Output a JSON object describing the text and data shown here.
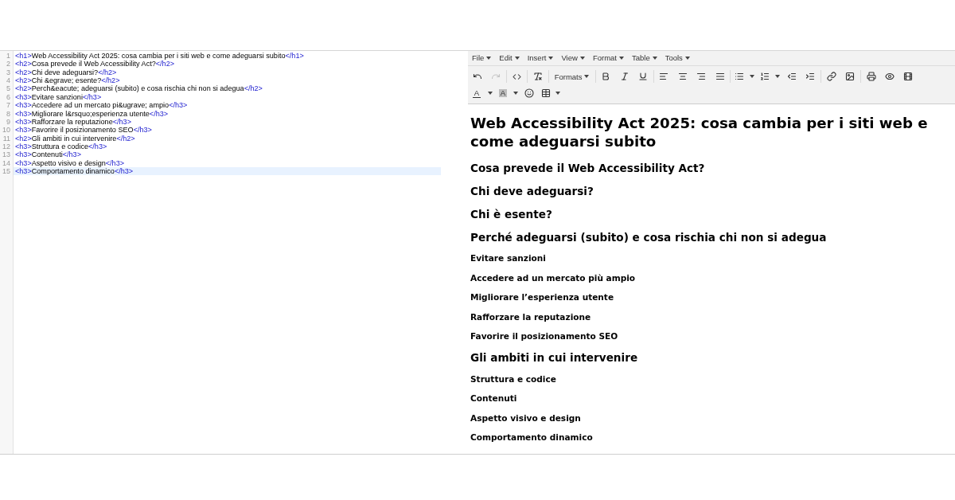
{
  "code_editor": {
    "lines": [
      {
        "number": "1",
        "active": false,
        "tokens": [
          {
            "kind": "tag",
            "text": "<h1>"
          },
          {
            "kind": "text",
            "text": "Web Accessibility Act 2025: cosa cambia per i siti web e come adeguarsi subito"
          },
          {
            "kind": "tag",
            "text": "</h1>"
          }
        ]
      },
      {
        "number": "2",
        "active": false,
        "tokens": [
          {
            "kind": "tag",
            "text": "<h2>"
          },
          {
            "kind": "text",
            "text": "Cosa prevede il Web Accessibility Act?"
          },
          {
            "kind": "tag",
            "text": "</h2>"
          }
        ]
      },
      {
        "number": "3",
        "active": false,
        "tokens": [
          {
            "kind": "tag",
            "text": "<h2>"
          },
          {
            "kind": "text",
            "text": "Chi deve adeguarsi?"
          },
          {
            "kind": "tag",
            "text": "</h2>"
          }
        ]
      },
      {
        "number": "4",
        "active": false,
        "tokens": [
          {
            "kind": "tag",
            "text": "<h2>"
          },
          {
            "kind": "text",
            "text": "Chi &egrave; esente?"
          },
          {
            "kind": "tag",
            "text": "</h2>"
          }
        ]
      },
      {
        "number": "5",
        "active": false,
        "tokens": [
          {
            "kind": "tag",
            "text": "<h2>"
          },
          {
            "kind": "text",
            "text": "Perch&eacute; adeguarsi (subito) e cosa rischia chi non si adegua"
          },
          {
            "kind": "tag",
            "text": "</h2>"
          }
        ]
      },
      {
        "number": "6",
        "active": false,
        "tokens": [
          {
            "kind": "tag",
            "text": "<h3>"
          },
          {
            "kind": "text",
            "text": "Evitare sanzioni"
          },
          {
            "kind": "tag",
            "text": "</h3>"
          }
        ]
      },
      {
        "number": "7",
        "active": false,
        "tokens": [
          {
            "kind": "tag",
            "text": "<h3>"
          },
          {
            "kind": "text",
            "text": "Accedere ad un mercato pi&ugrave; ampio"
          },
          {
            "kind": "tag",
            "text": "</h3>"
          }
        ]
      },
      {
        "number": "8",
        "active": false,
        "tokens": [
          {
            "kind": "tag",
            "text": "<h3>"
          },
          {
            "kind": "text",
            "text": "Migliorare l&rsquo;esperienza utente"
          },
          {
            "kind": "tag",
            "text": "</h3>"
          }
        ]
      },
      {
        "number": "9",
        "active": false,
        "tokens": [
          {
            "kind": "tag",
            "text": "<h3>"
          },
          {
            "kind": "text",
            "text": "Rafforzare la reputazione"
          },
          {
            "kind": "tag",
            "text": "</h3>"
          }
        ]
      },
      {
        "number": "10",
        "active": false,
        "tokens": [
          {
            "kind": "tag",
            "text": "<h3>"
          },
          {
            "kind": "text",
            "text": "Favorire il posizionamento SEO"
          },
          {
            "kind": "tag",
            "text": "</h3>"
          }
        ]
      },
      {
        "number": "11",
        "active": false,
        "tokens": [
          {
            "kind": "tag",
            "text": "<h2>"
          },
          {
            "kind": "text",
            "text": "Gli ambiti in cui intervenire"
          },
          {
            "kind": "tag",
            "text": "</h2>"
          }
        ]
      },
      {
        "number": "12",
        "active": false,
        "tokens": [
          {
            "kind": "tag",
            "text": "<h3>"
          },
          {
            "kind": "text",
            "text": "Struttura e codice"
          },
          {
            "kind": "tag",
            "text": "</h3>"
          }
        ]
      },
      {
        "number": "13",
        "active": false,
        "tokens": [
          {
            "kind": "tag",
            "text": "<h3>"
          },
          {
            "kind": "text",
            "text": "Contenuti"
          },
          {
            "kind": "tag",
            "text": "</h3>"
          }
        ]
      },
      {
        "number": "14",
        "active": false,
        "tokens": [
          {
            "kind": "tag",
            "text": "<h3>"
          },
          {
            "kind": "text",
            "text": "Aspetto visivo e design"
          },
          {
            "kind": "tag",
            "text": "</h3>"
          }
        ]
      },
      {
        "number": "15",
        "active": true,
        "tokens": [
          {
            "kind": "tag",
            "text": "<h3>"
          },
          {
            "kind": "text",
            "text": "Comportamento dinamico"
          },
          {
            "kind": "tag",
            "text": "</h3>"
          }
        ]
      }
    ]
  },
  "rich_text_editor": {
    "menu": [
      {
        "label": "File"
      },
      {
        "label": "Edit"
      },
      {
        "label": "Insert"
      },
      {
        "label": "View"
      },
      {
        "label": "Format"
      },
      {
        "label": "Table"
      },
      {
        "label": "Tools"
      }
    ],
    "toolbar": {
      "undo": {
        "disabled": false
      },
      "redo": {
        "disabled": true
      },
      "formats": {
        "label": "Formats"
      },
      "text_color": {
        "label": "A"
      },
      "background_color": {
        "label": "A"
      }
    },
    "document": {
      "headings": [
        {
          "kind": "h1",
          "text": "Web Accessibility Act 2025: cosa cambia per i siti web e come adeguarsi subito"
        },
        {
          "kind": "h2",
          "text": "Cosa prevede il Web Accessibility Act?"
        },
        {
          "kind": "h2",
          "text": "Chi deve adeguarsi?"
        },
        {
          "kind": "h2",
          "text": "Chi è esente?"
        },
        {
          "kind": "h2",
          "text": "Perché adeguarsi (subito) e cosa rischia chi non si adegua"
        },
        {
          "kind": "h3",
          "text": "Evitare sanzioni"
        },
        {
          "kind": "h3",
          "text": "Accedere ad un mercato più ampio"
        },
        {
          "kind": "h3",
          "text": "Migliorare l’esperienza utente"
        },
        {
          "kind": "h3",
          "text": "Rafforzare la reputazione"
        },
        {
          "kind": "h3",
          "text": "Favorire il posizionamento SEO"
        },
        {
          "kind": "h2",
          "text": "Gli ambiti in cui intervenire"
        },
        {
          "kind": "h3",
          "text": "Struttura e codice"
        },
        {
          "kind": "h3",
          "text": "Contenuti"
        },
        {
          "kind": "h3",
          "text": "Aspetto visivo e design"
        },
        {
          "kind": "h3",
          "text": "Comportamento dinamico"
        }
      ]
    }
  }
}
